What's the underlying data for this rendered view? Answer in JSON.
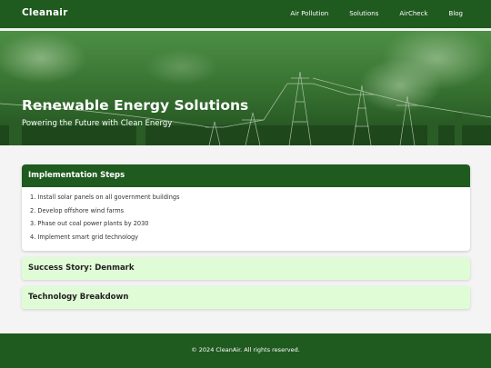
{
  "header": {
    "logo": "Cleanair",
    "nav": [
      "Air Pollution",
      "Solutions",
      "AirCheck",
      "Blog"
    ]
  },
  "hero": {
    "title": "Renewable Energy Solutions",
    "subtitle": "Powering the Future with Clean Energy"
  },
  "accordion": [
    {
      "title": "Implementation Steps",
      "expanded": true,
      "items": [
        "1. Install solar panels on all government buildings",
        "2. Develop offshore wind farms",
        "3. Phase out coal power plants by 2030",
        "4. Implement smart grid technology"
      ]
    },
    {
      "title": "Success Story: Denmark",
      "expanded": false
    },
    {
      "title": "Technology Breakdown",
      "expanded": false
    }
  ],
  "footer": {
    "text": "© 2024 CleanAir. All rights reserved."
  },
  "colors": {
    "primary": "#1f5a1f",
    "collapsed_panel": "#e0fcd6",
    "background": "#f4f4f4"
  }
}
